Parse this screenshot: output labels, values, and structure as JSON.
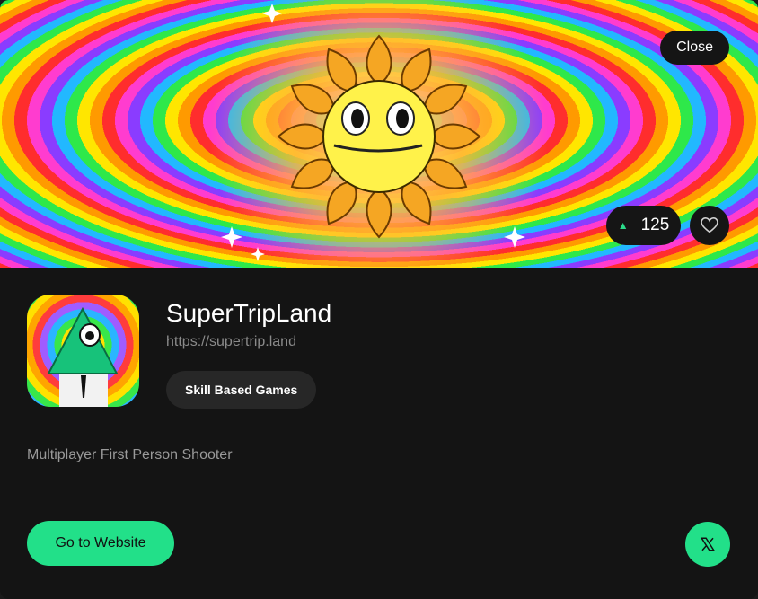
{
  "card": {
    "close_label": "Close",
    "upvote_count": "125",
    "title": "SuperTripLand",
    "url": "https://supertrip.land",
    "tag": "Skill Based Games",
    "description": "Multiplayer First Person Shooter",
    "cta_label": "Go to Website",
    "icons": {
      "upvote": "triangle-up-icon",
      "favorite": "heart-icon",
      "social": "x-logo-icon"
    },
    "colors": {
      "accent": "#22e089",
      "card_bg": "#141414",
      "pill_bg": "#151515",
      "tag_bg": "#272727"
    }
  }
}
